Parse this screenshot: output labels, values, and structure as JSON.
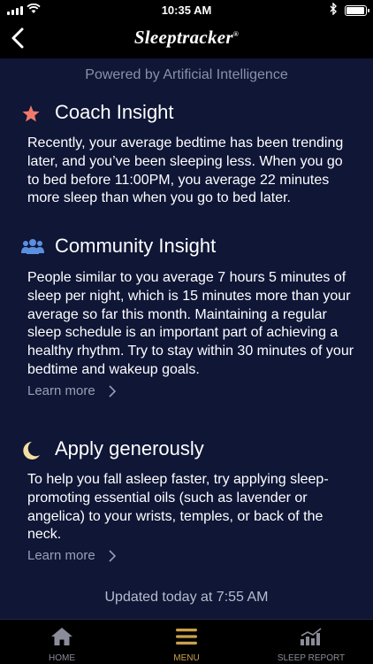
{
  "status_bar": {
    "time": "10:35 AM"
  },
  "header": {
    "brand": "Sleeptracker",
    "brand_mark": "®"
  },
  "powered_by": "Powered by Artificial Intelligence",
  "sections": [
    {
      "icon": "star-icon",
      "title": "Coach Insight",
      "body": "Recently, your average bedtime has been trending later, and you’ve been sleeping less. When you go to bed before 11:00PM, you average 22 minutes more sleep than when you go to bed later."
    },
    {
      "icon": "community-icon",
      "title": "Community Insight",
      "body": "People similar to you average 7 hours 5 minutes of sleep per night, which is 15 minutes more than your average so far this month. Maintaining a regular sleep schedule is an important part of achieving a healthy rhythm. Try to stay within 30 minutes of your bedtime and wakeup goals.",
      "link": "Learn more"
    },
    {
      "icon": "moon-icon",
      "title": "Apply generously",
      "body": "To help you fall asleep faster, try applying sleep-promoting essential oils (such as lavender or angelica) to your wrists, temples, or back of the neck.",
      "link": "Learn more"
    }
  ],
  "updated": "Updated today at 7:55 AM",
  "tabs": [
    {
      "label": "HOME",
      "icon": "home-icon"
    },
    {
      "label": "MENU",
      "icon": "menu-icon",
      "active": true
    },
    {
      "label": "SLEEP REPORT",
      "icon": "sleep-report-icon"
    }
  ],
  "colors": {
    "background": "#0f1636",
    "accent": "#c9a14a",
    "star": "#ef7a6b",
    "community": "#5b8fe0",
    "moon": "#f3dfa0"
  }
}
